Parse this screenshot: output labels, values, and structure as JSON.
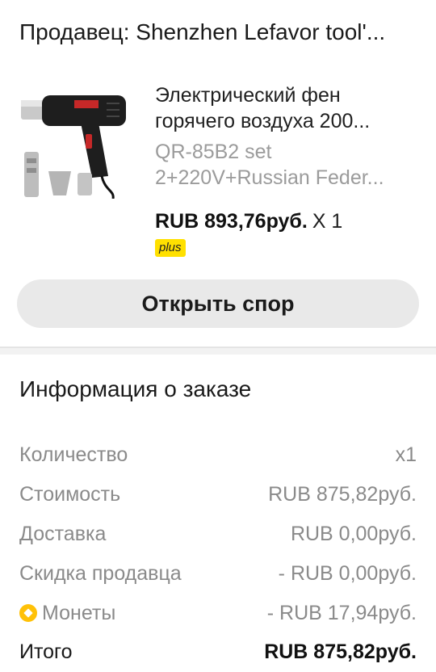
{
  "seller": {
    "text": "Продавец: Shenzhen Lefavor tool'..."
  },
  "product": {
    "title": "Электрический фен горячего воздуха 200...",
    "variant": "QR-85B2 set 2+220V+Russian Feder...",
    "price": "RUB 893,76руб.",
    "quantity": "X 1",
    "badge": "plus",
    "image": "heat-gun-product-image"
  },
  "dispute_button": {
    "label": "Открыть спор"
  },
  "order_info": {
    "title": "Информация о заказе",
    "rows": [
      {
        "label": "Количество",
        "value": "x1"
      },
      {
        "label": "Стоимость",
        "value": "RUB 875,82руб."
      },
      {
        "label": "Доставка",
        "value": "RUB 0,00руб."
      },
      {
        "label": "Скидка продавца",
        "value": "- RUB 0,00руб."
      },
      {
        "label": "Монеты",
        "value": "- RUB 17,94руб.",
        "icon": "coin-icon"
      },
      {
        "label": "Итого",
        "value": "RUB 875,82руб."
      }
    ]
  },
  "colors": {
    "badge_yellow": "#ffe000",
    "coin": "#ffc107",
    "button_bg": "#e9e9e9",
    "muted_text": "#8a8a8a"
  }
}
